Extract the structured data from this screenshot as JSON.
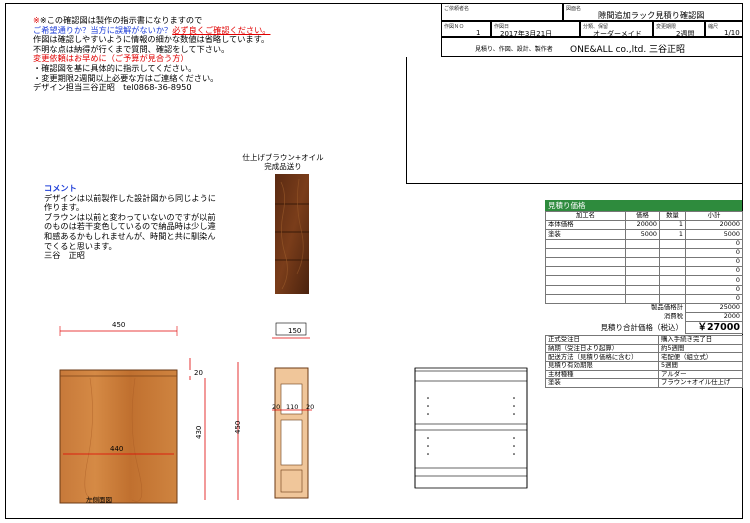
{
  "notice": {
    "line1": "※この確認図は製作の指示書になりますので",
    "line2a": "ご希望通りか？当方に誤解がないか？",
    "line2b": "必ず良くご確認ください。",
    "line3": "作図は確認しやすいように情報の細かな数値は省略しています。",
    "line4": "不明な点は納得が行くまで質問、確認をして下さい。",
    "line5": "変更依頼はお早めに（ご予算が見合う方）",
    "line6": "・確認図を基に具体的に指示してください。",
    "line7": "・変更期限2週間以上必要な方はご連絡ください。",
    "line8": "デザイン担当三谷正昭　tel0868-36-8950"
  },
  "title_block": {
    "customer_label": "ご依頼者名",
    "drawing_label": "図面名",
    "drawing_name": "隙間追加ラック見積り確認図",
    "sheet_no_label": "作図ＮＯ",
    "sheet_no": "1",
    "date_label": "作図日",
    "date": "2017年3月21日",
    "category_label": "分類、保留",
    "category": "オーダーメイド",
    "deadline_label": "変更期限",
    "deadline": "2週間",
    "scale_label": "縮尺",
    "scale": "1/10",
    "credits_label": "見積り、作図、設計、製作者",
    "company": "ONE&ALL co.,ltd. 三谷正昭"
  },
  "comment": {
    "heading": "コメント",
    "lines": [
      "デザインは以前製作した設計図から同じように",
      "作ります。",
      "ブラウンは以前と変わっていないのですが以前",
      "のものは若干変色しているので納品時は少し違",
      "和感あるかもしれませんが、時間と共に馴染ん",
      "でくると思います。",
      "三谷　正昭"
    ]
  },
  "finish_label": {
    "line1": "仕上げブラウン+オイル",
    "line2": "完成品送り"
  },
  "estimate": {
    "header": "見積り価格",
    "columns": [
      "加工名",
      "価格",
      "数量",
      "小計"
    ],
    "rows": [
      [
        "本体価格",
        "20000",
        "1",
        "20000"
      ],
      [
        "塗装",
        "5000",
        "1",
        "5000"
      ],
      [
        "",
        "",
        "",
        "0"
      ],
      [
        "",
        "",
        "",
        "0"
      ],
      [
        "",
        "",
        "",
        "0"
      ],
      [
        "",
        "",
        "",
        "0"
      ],
      [
        "",
        "",
        "",
        "0"
      ],
      [
        "",
        "",
        "",
        "0"
      ],
      [
        "",
        "",
        "",
        "0"
      ]
    ],
    "product_total_label": "製品価格計",
    "product_total": "25000",
    "tax_label": "消費税",
    "tax": "2000",
    "grand_total_label": "見積り合計価格（税込）",
    "grand_total": "￥27000",
    "specs": [
      [
        "正式受注日",
        "購入手続き完了日"
      ],
      [
        "納期（受注日より起算）",
        "約5週間"
      ],
      [
        "配送方法（見積り価格に含む）",
        "宅配便（組立式）"
      ],
      [
        "見積り有効期限",
        "5週間"
      ],
      [
        "主材種種",
        "アルダー"
      ],
      [
        "塗装",
        "ブラウン+オイル仕上げ"
      ]
    ]
  },
  "dims": {
    "front_width": "450",
    "front_inner": "440",
    "front_top": "20",
    "front_height_inner": "430",
    "side_height": "450",
    "side_depth": "150",
    "side_left": "20",
    "side_mid": "110",
    "side_right": "20"
  },
  "caption": "左側面図"
}
